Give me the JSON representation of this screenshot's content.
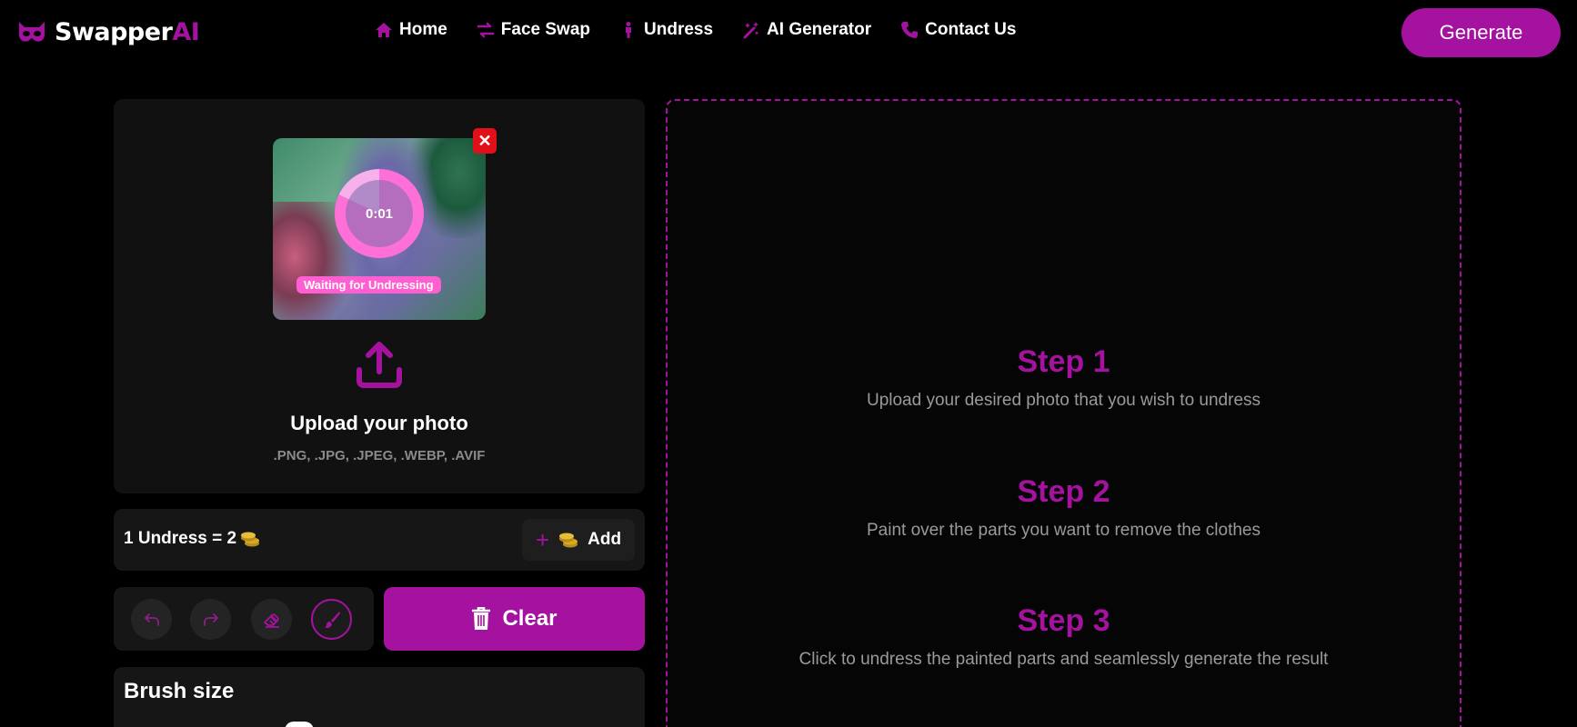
{
  "header": {
    "logo": {
      "name": "Swapper",
      "suffix": "AI"
    },
    "nav": [
      {
        "label": "Home",
        "icon": "home-icon"
      },
      {
        "label": "Face Swap",
        "icon": "swap-arrows-icon"
      },
      {
        "label": "Undress",
        "icon": "person-icon"
      },
      {
        "label": "AI Generator",
        "icon": "magic-wand-icon"
      },
      {
        "label": "Contact Us",
        "icon": "phone-icon"
      }
    ],
    "generate_label": "Generate"
  },
  "upload": {
    "timer": "0:01",
    "progress": 0.82,
    "status": "Waiting for Undressing",
    "close_symbol": "✕",
    "title": "Upload your photo",
    "formats": ".PNG, .JPG, .JPEG, .WEBP, .AVIF"
  },
  "cost": {
    "text": "1 Undress = 2",
    "add_symbol": "+",
    "add_label": "Add"
  },
  "tools": {
    "items": [
      {
        "name": "undo-icon",
        "active": false
      },
      {
        "name": "redo-icon",
        "active": false
      },
      {
        "name": "eraser-icon",
        "active": false
      },
      {
        "name": "brush-icon",
        "active": true
      }
    ],
    "clear_label": "Clear"
  },
  "brush": {
    "title": "Brush size"
  },
  "steps": [
    {
      "title": "Step 1",
      "desc": "Upload your desired photo that you wish to undress"
    },
    {
      "title": "Step 2",
      "desc": "Paint over the parts you want to remove the clothes"
    },
    {
      "title": "Step 3",
      "desc": "Click to undress the painted parts and seamlessly generate the result"
    }
  ],
  "colors": {
    "accent": "#a4129f",
    "background": "#000000",
    "card": "#111111",
    "close_red": "#e10f17"
  }
}
